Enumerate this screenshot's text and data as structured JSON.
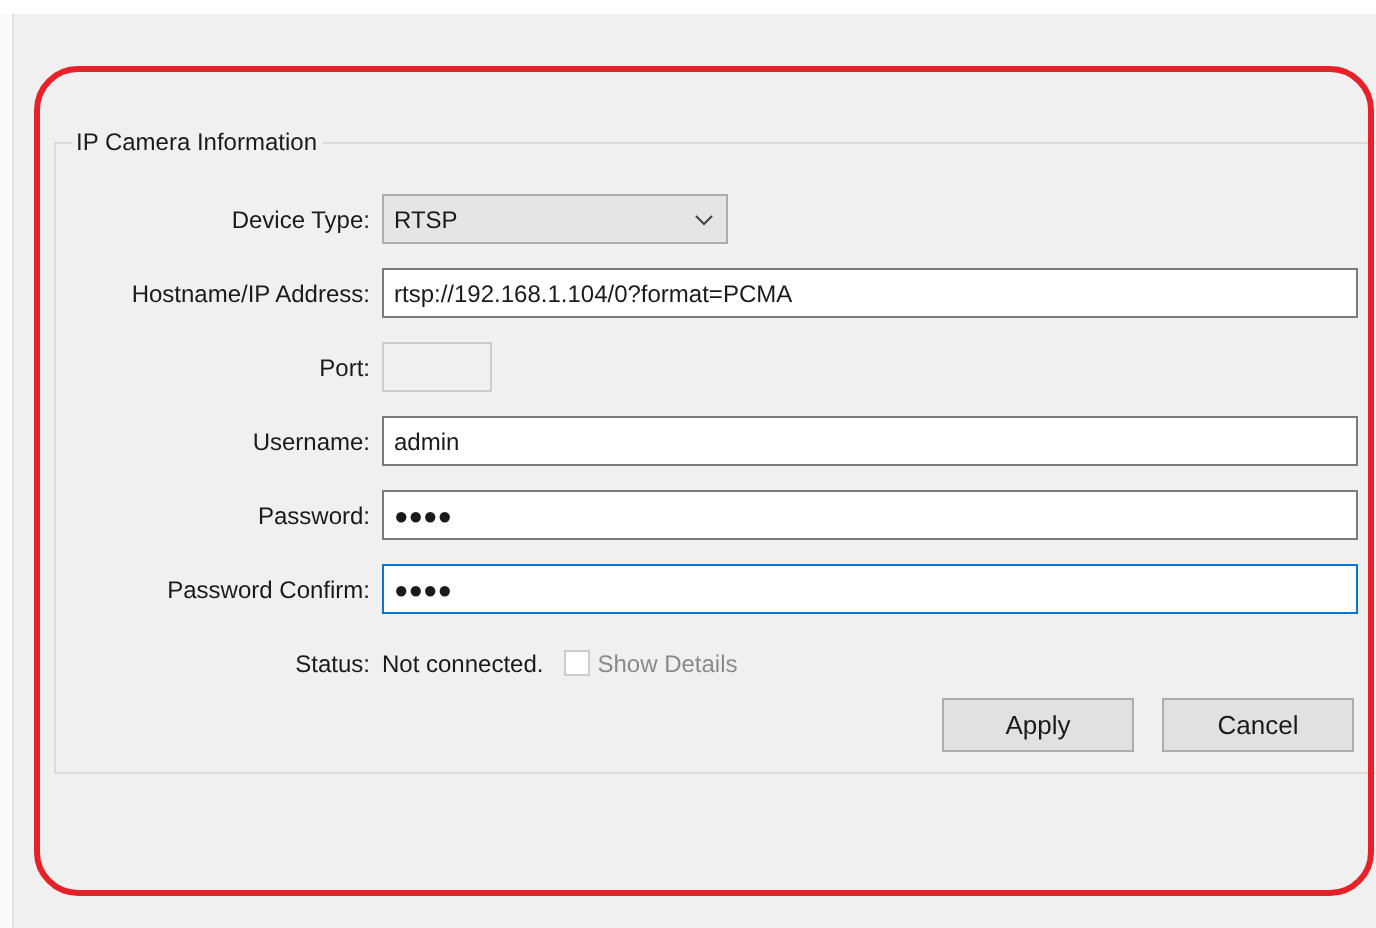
{
  "group": {
    "title": "IP Camera Information"
  },
  "fields": [
    {
      "kind": "combo",
      "label": "Device Type:",
      "value": "RTSP",
      "disabled": false,
      "focused": false
    },
    {
      "kind": "text",
      "label": "Hostname/IP Address:",
      "value": "rtsp://192.168.1.104/0?format=PCMA",
      "disabled": false,
      "focused": false
    },
    {
      "kind": "short",
      "label": "Port:",
      "disabled": true,
      "focused": false
    },
    {
      "kind": "text",
      "label": "Username:",
      "value": "admin",
      "disabled": false,
      "focused": false
    },
    {
      "kind": "text",
      "label": "Password:",
      "value": "●●●●",
      "disabled": false,
      "focused": false
    },
    {
      "kind": "text",
      "label": "Password Confirm:",
      "value": "●●●●",
      "disabled": false,
      "focused": true
    }
  ],
  "status": {
    "label": "Status:",
    "value": "Not connected.",
    "show_details": {
      "label": "Show Details",
      "checked": false,
      "disabled": true
    }
  },
  "buttons": [
    "Apply",
    "Cancel"
  ]
}
